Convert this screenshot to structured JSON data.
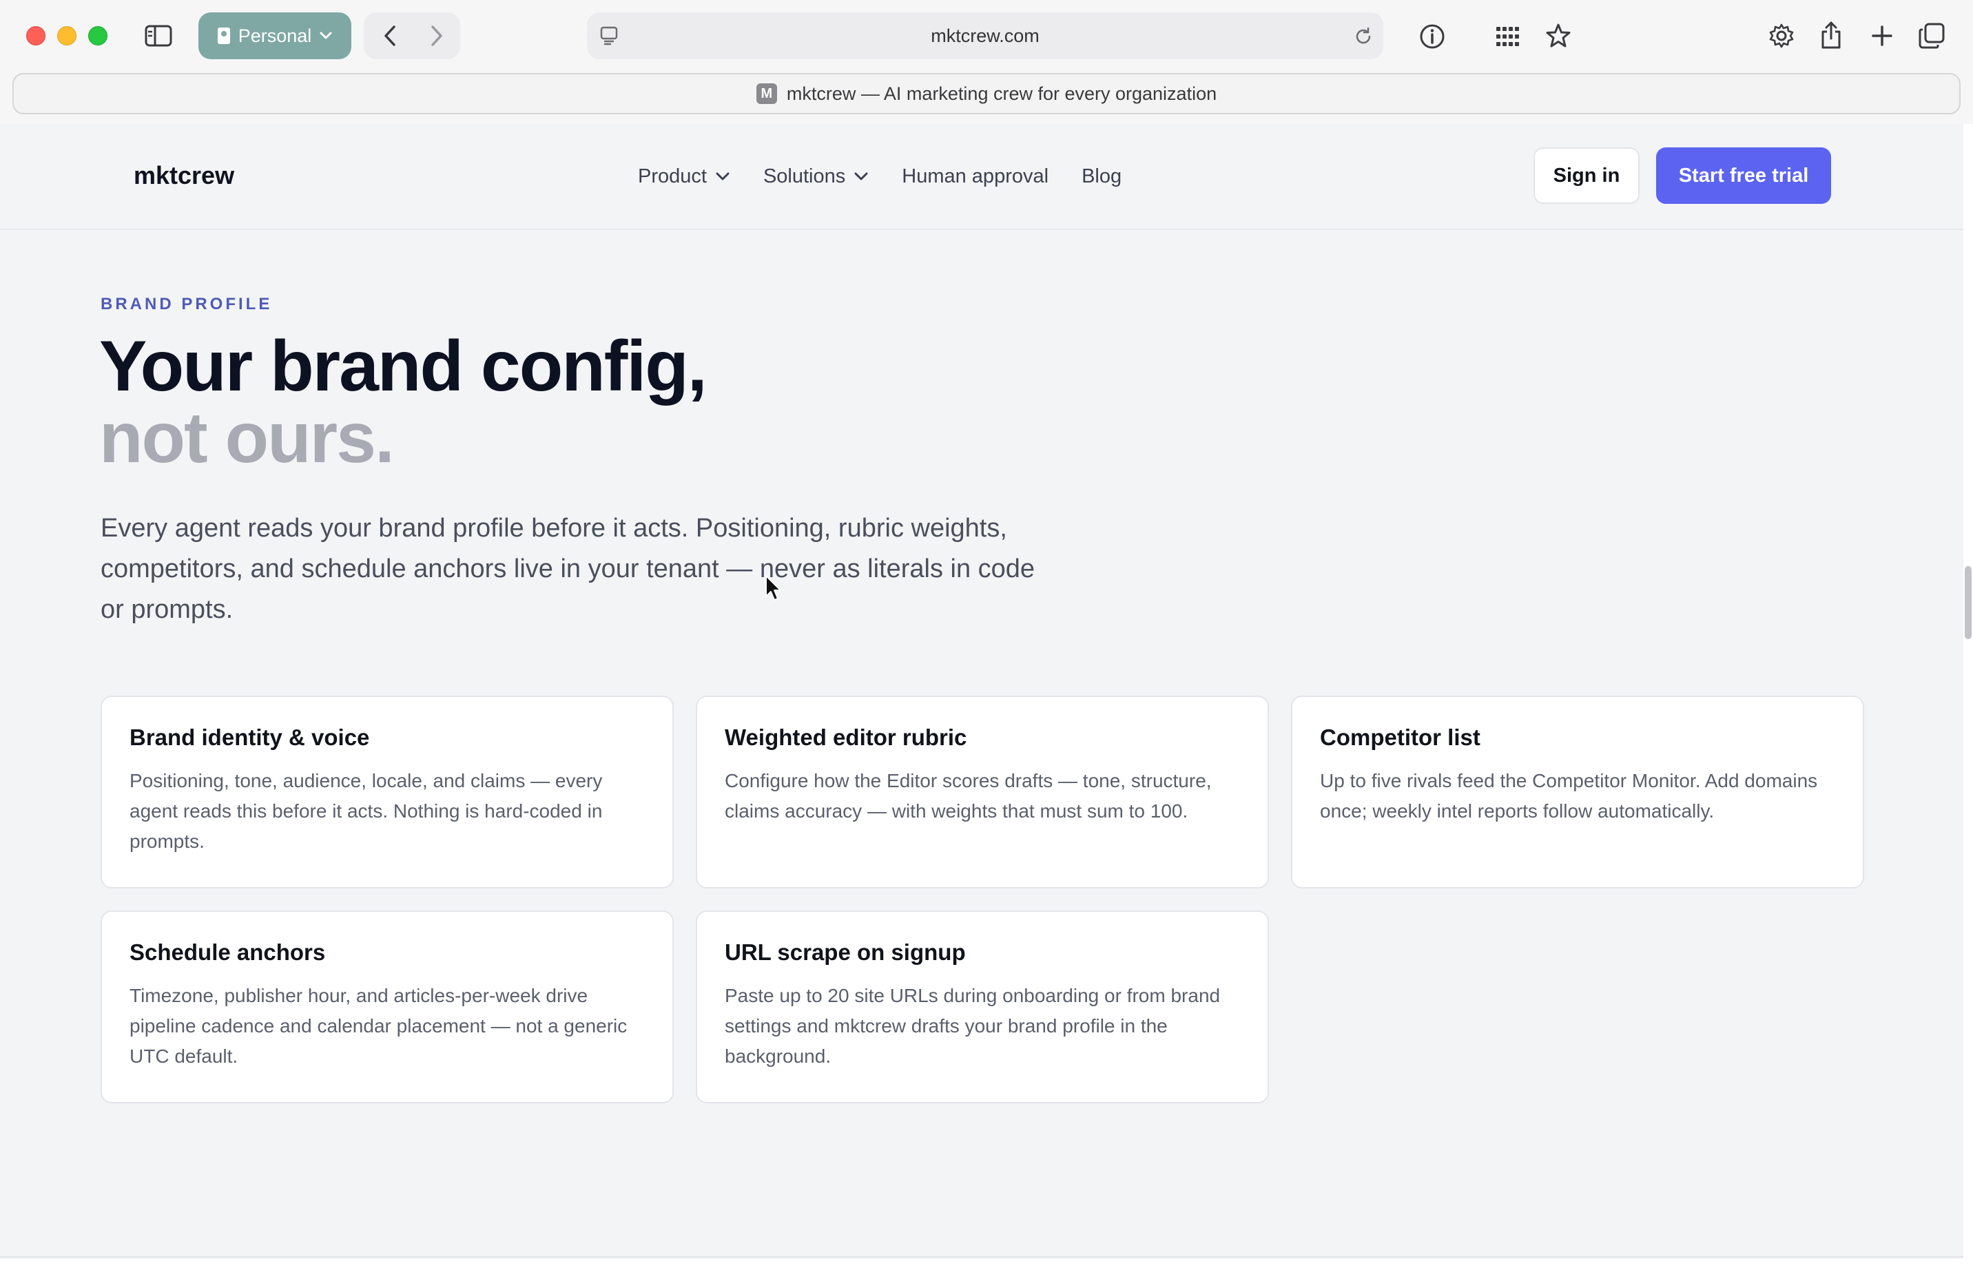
{
  "browser": {
    "profile_label": "Personal",
    "address": "mktcrew.com",
    "tab_favicon_letter": "M",
    "tab_title": "mktcrew — AI marketing crew for every organization",
    "icons": [
      "sidebar-icon",
      "back-icon",
      "forward-icon",
      "reader-icon",
      "reload-icon",
      "info-icon",
      "grid-icon",
      "star-icon",
      "gear-icon",
      "share-icon",
      "plus-icon",
      "tabs-overview-icon"
    ]
  },
  "site": {
    "logo": "mktcrew",
    "nav": [
      {
        "label": "Product",
        "has_dropdown": true
      },
      {
        "label": "Solutions",
        "has_dropdown": true
      },
      {
        "label": "Human approval",
        "has_dropdown": false
      },
      {
        "label": "Blog",
        "has_dropdown": false
      }
    ],
    "sign_in": "Sign in",
    "start_trial": "Start free trial"
  },
  "hero": {
    "eyebrow": "BRAND PROFILE",
    "headline_line1": "Your brand config,",
    "headline_line2": "not ours.",
    "lede": "Every agent reads your brand profile before it acts. Positioning, rubric weights, competitors, and schedule anchors live in your tenant — never as literals in code or prompts."
  },
  "cards": [
    {
      "title": "Brand identity & voice",
      "body": "Positioning, tone, audience, locale, and claims — every agent reads this before it acts. Nothing is hard-coded in prompts."
    },
    {
      "title": "Weighted editor rubric",
      "body": "Configure how the Editor scores drafts — tone, structure, claims accuracy — with weights that must sum to 100."
    },
    {
      "title": "Competitor list",
      "body": "Up to five rivals feed the Competitor Monitor. Add domains once; weekly intel reports follow automatically."
    },
    {
      "title": "Schedule anchors",
      "body": "Timezone, publisher hour, and articles-per-week drive pipeline cadence and calendar placement — not a generic UTC default."
    },
    {
      "title": "URL scrape on signup",
      "body": "Paste up to 20 site URLs during onboarding or from brand settings and mktcrew drafts your brand profile in the background."
    }
  ],
  "colors": {
    "accent": "#5b63f0",
    "eyebrow": "#4e5bb5",
    "headline_dark": "#0d1222",
    "headline_muted": "#a8abb3",
    "page_bg": "#f3f4f6"
  }
}
